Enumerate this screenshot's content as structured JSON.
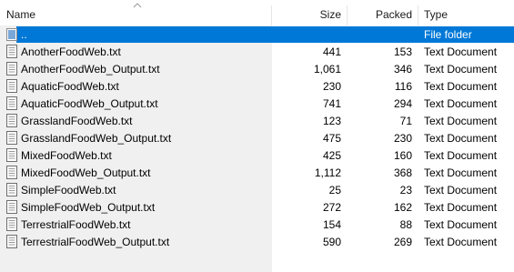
{
  "header": {
    "name_label": "Name",
    "size_label": "Size",
    "packed_label": "Packed",
    "type_label": "Type"
  },
  "parent_row": {
    "name": "..",
    "size": "",
    "packed": "",
    "type": "File folder"
  },
  "files": [
    {
      "name": "AnotherFoodWeb.txt",
      "size": "441",
      "packed": "153",
      "type": "Text Document"
    },
    {
      "name": "AnotherFoodWeb_Output.txt",
      "size": "1,061",
      "packed": "346",
      "type": "Text Document"
    },
    {
      "name": "AquaticFoodWeb.txt",
      "size": "230",
      "packed": "116",
      "type": "Text Document"
    },
    {
      "name": "AquaticFoodWeb_Output.txt",
      "size": "741",
      "packed": "294",
      "type": "Text Document"
    },
    {
      "name": "GrasslandFoodWeb.txt",
      "size": "123",
      "packed": "71",
      "type": "Text Document"
    },
    {
      "name": "GrasslandFoodWeb_Output.txt",
      "size": "475",
      "packed": "230",
      "type": "Text Document"
    },
    {
      "name": "MixedFoodWeb.txt",
      "size": "425",
      "packed": "160",
      "type": "Text Document"
    },
    {
      "name": "MixedFoodWeb_Output.txt",
      "size": "1,112",
      "packed": "368",
      "type": "Text Document"
    },
    {
      "name": "SimpleFoodWeb.txt",
      "size": "25",
      "packed": "23",
      "type": "Text Document"
    },
    {
      "name": "SimpleFoodWeb_Output.txt",
      "size": "272",
      "packed": "162",
      "type": "Text Document"
    },
    {
      "name": "TerrestrialFoodWeb.txt",
      "size": "154",
      "packed": "88",
      "type": "Text Document"
    },
    {
      "name": "TerrestrialFoodWeb_Output.txt",
      "size": "590",
      "packed": "269",
      "type": "Text Document"
    }
  ],
  "icons": {
    "sort": "sort-ascending-icon",
    "parent": "parent-folder-icon",
    "file": "text-document-icon"
  },
  "colors": {
    "selection": "#0078d7",
    "pane_gray": "#f0f0f0"
  }
}
